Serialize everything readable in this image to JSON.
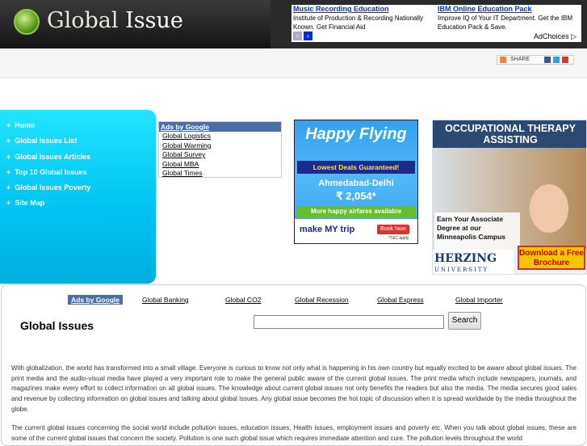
{
  "logo": {
    "word1": "Global",
    "word2": "Issue"
  },
  "top_ad": {
    "col1_title": "Music Recording Education",
    "col1_text": "Institute of Production & Recording Nationally Known. Get Financial Aid",
    "col2_title": "IBM Online Education Pack",
    "col2_text": "Improve IQ of Your IT Department. Get the IBM Education Pack & Save.",
    "adchoices": "AdChoices"
  },
  "share": {
    "label": "SHARE"
  },
  "nav": {
    "items": [
      {
        "label": "Home"
      },
      {
        "label": "Global Issues List"
      },
      {
        "label": "Global Issues Articles"
      },
      {
        "label": "Top 10 Global Issues"
      },
      {
        "label": "Global Issues Poverty"
      },
      {
        "label": "Site Map"
      }
    ],
    "bullet": "+"
  },
  "side_ads": {
    "header": "Ads by Google",
    "links": [
      "Global Logistics",
      "Global Warming",
      "Global Survey",
      "Global MBA",
      "Global Times"
    ]
  },
  "banner1": {
    "title": "Happy Flying",
    "deal": "Lowest Deals Guaranteed!",
    "route": "Ahmedabad-Delhi",
    "price": "₹ 2,054*",
    "more": "More happy airfares available",
    "brand": "make MY trip",
    "book": "Book Now",
    "tc": "*T&C apply"
  },
  "banner2": {
    "top": "OCCUPATIONAL THERAPY ASSISTING",
    "card": "Earn Your Associate Degree at our Minneapolis Campus",
    "brand": "HERZING",
    "sub": "UNIVERSITY",
    "download": "Download a Free Brochure"
  },
  "link_bar": {
    "header": "Ads by Google",
    "links": [
      "Global Banking",
      "Global CO2",
      "Global Recession",
      "Global Express",
      "Global Importer"
    ]
  },
  "page_title": "Global Issues",
  "search": {
    "value": "",
    "button": "Search"
  },
  "paragraphs": [
    "With globalization, the world has transformed into a small village. Everyone is curious to know not only what is happening in his own country but equally excited to be aware about global issues. The print media and the audio-visual media have played a very important role to make the general public aware of the current global issues. The print media which include newspapers, journals, and magazines make every effort to collect information on all global issues. The knowledge about current global issues not only benefits the readers but also the media. The media secures good sales and revenue by collecting information on global issues and talking about global issues. Any global issue becomes the hot topic of discussion when it is spread worldwide by the media throughout the globe.",
    "The current global issues concerning the social world include pollution issues, education issues, Health issues, employment issues and poverty etc. When you talk about global issues, these are some of the current global issues that concern the society. Pollution is one such global issue which requires immediate attention and cure. The pollution levels throughout the world"
  ]
}
